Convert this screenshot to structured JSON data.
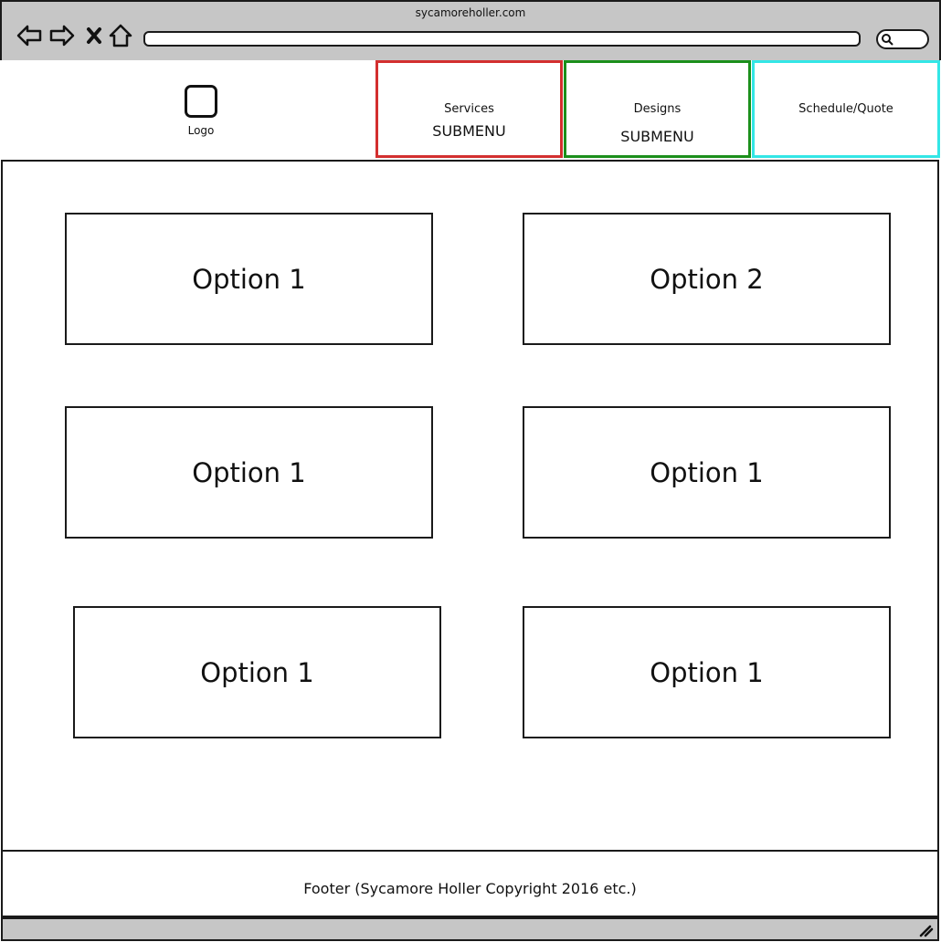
{
  "browser": {
    "title": "sycamoreholler.com",
    "icons": [
      "back-arrow-icon",
      "forward-arrow-icon",
      "close-icon",
      "home-icon",
      "search-icon",
      "resize-grip-icon"
    ]
  },
  "header": {
    "logo_label": "Logo",
    "nav": [
      {
        "label": "Services",
        "sub": "SUBMENU",
        "color": "#d32f2f"
      },
      {
        "label": "Designs",
        "sub": "SUBMENU",
        "color": "#1b8f1b"
      },
      {
        "label": "Schedule/Quote",
        "sub": "",
        "color": "#33e6e6"
      }
    ]
  },
  "main": {
    "options": [
      "Option 1",
      "Option 2",
      "Option 1",
      "Option 1",
      "Option 1",
      "Option 1"
    ]
  },
  "footer": {
    "text": "Footer (Sycamore Holler Copyright 2016 etc.)"
  },
  "colors": {
    "chrome_bg": "#c6c6c6",
    "border": "#1a1a1a"
  }
}
